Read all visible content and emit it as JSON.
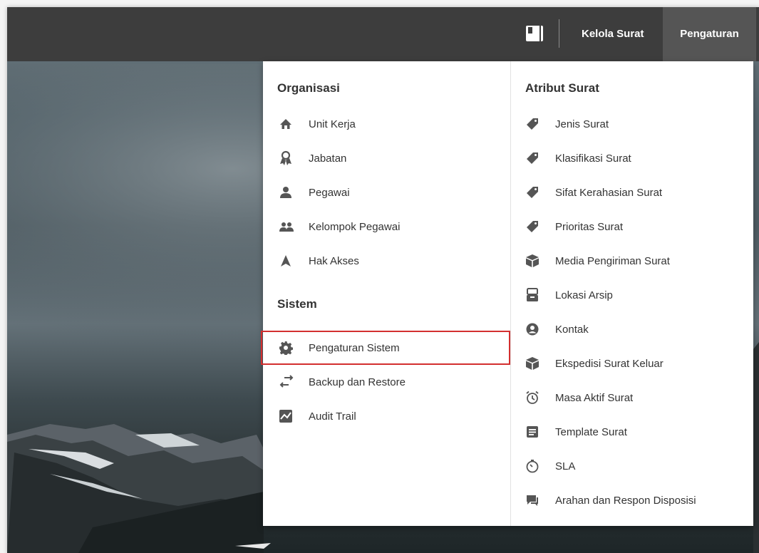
{
  "topbar": {
    "book_icon": "book-icon",
    "kelola_surat": "Kelola Surat",
    "pengaturan": "Pengaturan"
  },
  "menu": {
    "organisasi": {
      "title": "Organisasi",
      "items": [
        {
          "label": "Unit Kerja",
          "icon": "home-icon"
        },
        {
          "label": "Jabatan",
          "icon": "award-icon"
        },
        {
          "label": "Pegawai",
          "icon": "user-icon"
        },
        {
          "label": "Kelompok Pegawai",
          "icon": "users-icon"
        },
        {
          "label": "Hak Akses",
          "icon": "arrow-up-icon"
        }
      ]
    },
    "sistem": {
      "title": "Sistem",
      "items": [
        {
          "label": "Pengaturan Sistem",
          "icon": "gear-icon",
          "highlighted": true
        },
        {
          "label": "Backup dan Restore",
          "icon": "swap-icon"
        },
        {
          "label": "Audit Trail",
          "icon": "chart-icon"
        }
      ]
    },
    "atribut": {
      "title": "Atribut Surat",
      "items": [
        {
          "label": "Jenis Surat",
          "icon": "tag-icon"
        },
        {
          "label": "Klasifikasi Surat",
          "icon": "tag-icon"
        },
        {
          "label": "Sifat Kerahasian Surat",
          "icon": "tag-icon"
        },
        {
          "label": "Prioritas Surat",
          "icon": "tag-icon"
        },
        {
          "label": "Media Pengiriman Surat",
          "icon": "box-icon"
        },
        {
          "label": "Lokasi Arsip",
          "icon": "archive-icon"
        },
        {
          "label": "Kontak",
          "icon": "contact-icon"
        },
        {
          "label": "Ekspedisi Surat Keluar",
          "icon": "box-icon"
        },
        {
          "label": "Masa Aktif Surat",
          "icon": "alarm-icon"
        },
        {
          "label": "Template Surat",
          "icon": "document-icon"
        },
        {
          "label": "SLA",
          "icon": "timer-icon"
        },
        {
          "label": "Arahan dan Respon Disposisi",
          "icon": "chat-icon"
        }
      ]
    }
  },
  "colors": {
    "topbar": "#3d3d3d",
    "active_nav": "#555555",
    "highlight_border": "#d32f2f",
    "icon": "#555555"
  }
}
